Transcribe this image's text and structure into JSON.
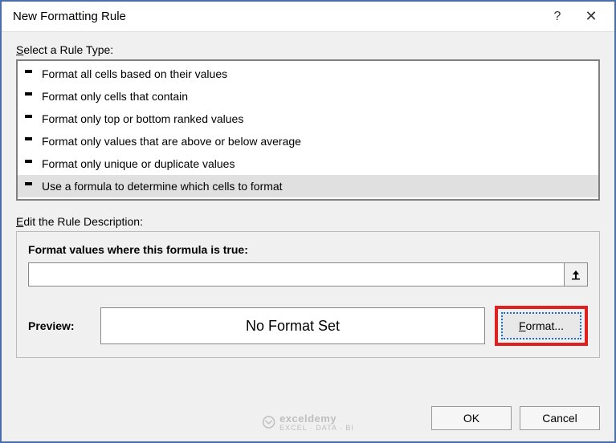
{
  "titlebar": {
    "title": "New Formatting Rule",
    "help": "?",
    "close": "✕"
  },
  "select_label_pre": "S",
  "select_label_post": "elect a Rule Type:",
  "rules": [
    "Format all cells based on their values",
    "Format only cells that contain",
    "Format only top or bottom ranked values",
    "Format only values that are above or below average",
    "Format only unique or duplicate values",
    "Use a formula to determine which cells to format"
  ],
  "selected_rule_index": 5,
  "edit_label_pre": "E",
  "edit_label_post": "dit the Rule Description:",
  "formula_label_pre": "F",
  "formula_label_mid": "o",
  "formula_label_post": "rmat values where this formula is true:",
  "formula_value": "",
  "preview_label": "Preview:",
  "preview_text": "No Format Set",
  "format_btn_pre": "F",
  "format_btn_post": "ormat...",
  "ok_label": "OK",
  "cancel_label": "Cancel",
  "watermark": {
    "name": "exceldemy",
    "sub": "EXCEL · DATA · BI"
  }
}
